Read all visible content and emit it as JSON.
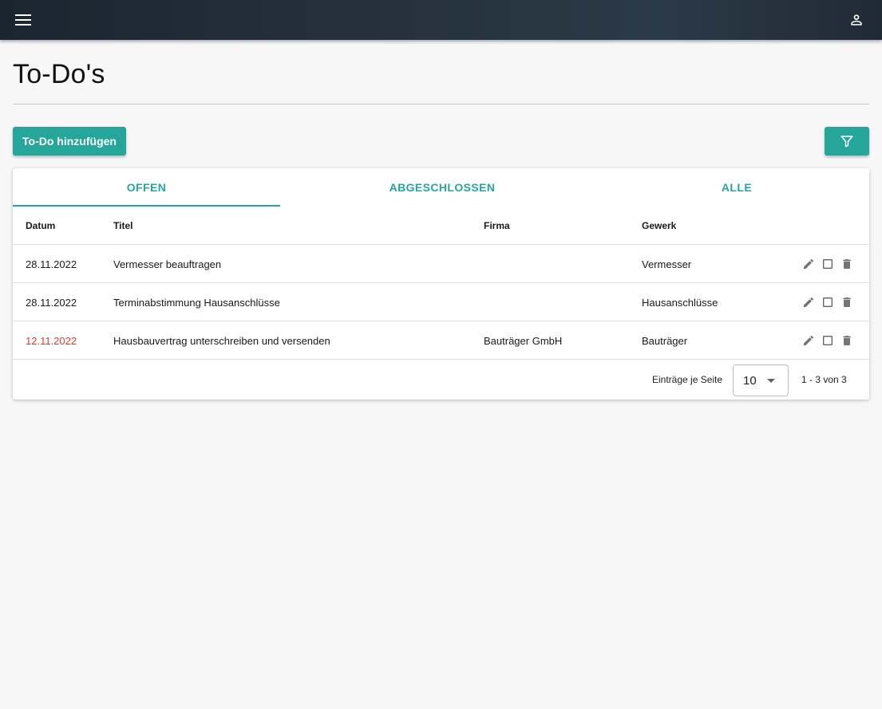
{
  "appbar": {
    "menu_icon": "menu-icon",
    "user_icon": "account-icon"
  },
  "page": {
    "title": "To-Do's"
  },
  "toolbar": {
    "add_label": "To-Do hinzufügen",
    "filter_icon": "filter-icon",
    "accent": "#26a69a"
  },
  "tabs": [
    {
      "label": "OFFEN",
      "active": true
    },
    {
      "label": "ABGESCHLOSSEN",
      "active": false
    },
    {
      "label": "ALLE",
      "active": false
    }
  ],
  "table": {
    "columns": {
      "datum": "Datum",
      "titel": "Titel",
      "firma": "Firma",
      "gewerk": "Gewerk"
    },
    "rows": [
      {
        "datum": "28.11.2022",
        "titel": "Vermesser beauftragen",
        "firma": "",
        "gewerk": "Vermesser",
        "overdue": false
      },
      {
        "datum": "28.11.2022",
        "titel": "Terminabstimmung Hausanschlüsse",
        "firma": "",
        "gewerk": "Hausanschlüsse",
        "overdue": false
      },
      {
        "datum": "12.11.2022",
        "titel": "Hausbauvertrag unterschreiben und versenden",
        "firma": "Bauträger GmbH",
        "gewerk": "Bauträger",
        "overdue": true
      }
    ],
    "overdue_color": "#e53935",
    "row_action_icons": [
      "pencil-icon",
      "checkbox-icon",
      "trash-icon"
    ]
  },
  "pagination": {
    "per_page_label": "Einträge je Seite",
    "per_page_value": "10",
    "range": "1 - 3 von 3"
  }
}
